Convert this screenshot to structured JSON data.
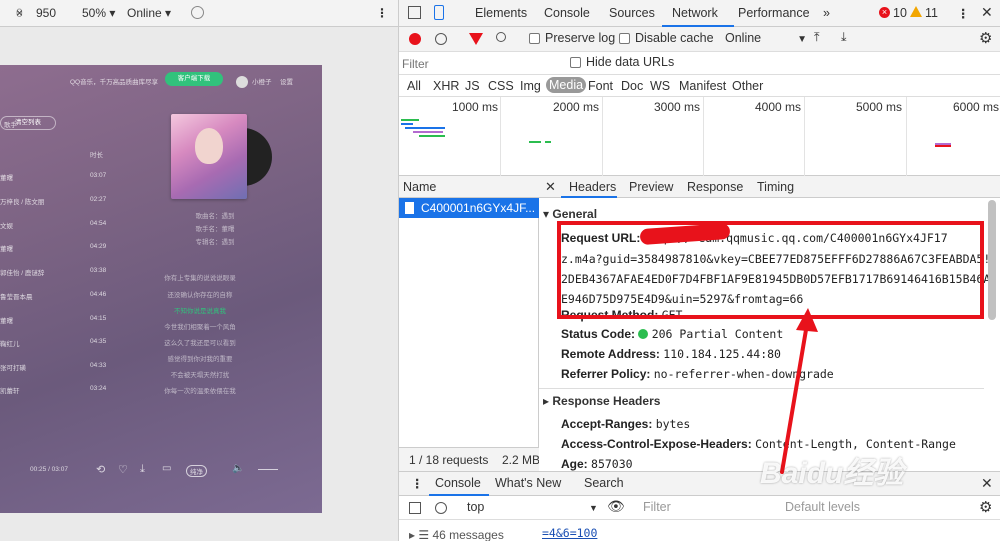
{
  "device_toolbar": {
    "x_sep": "×",
    "height": "950",
    "zoom": "50%",
    "network": "Online"
  },
  "phone": {
    "promo": "QQ音乐，千万高品质曲库尽享",
    "download_btn": "客户端下载",
    "user": "小橙子",
    "settings": "设置",
    "clear_btn": "清空列表",
    "col_singer": "歌手",
    "col_duration": "时长",
    "songs": [
      {
        "title": "",
        "singer": "董曙",
        "time": "03:07"
      },
      {
        "title": "",
        "singer": "万梓良 / 陈文丽",
        "time": "02:27"
      },
      {
        "title": "",
        "singer": "文娱",
        "time": "04:54"
      },
      {
        "title": "",
        "singer": "董曙",
        "time": "04:29"
      },
      {
        "title": "",
        "singer": "郭佳怡 / 鹿谜辞",
        "time": "03:38"
      },
      {
        "title": "",
        "singer": "鲁莹晋本晨",
        "time": "04:46"
      },
      {
        "title": "",
        "singer": "董曙",
        "time": "04:15"
      },
      {
        "title": "",
        "singer": "鞠红儿",
        "time": "04:35"
      },
      {
        "title": "",
        "singer": "张可打磺",
        "time": "04:33"
      },
      {
        "title": "",
        "singer": "凯蕾轩",
        "time": "03:24"
      }
    ],
    "meta": [
      "歌曲名：遇到",
      "歌手名：董曙",
      "专辑名：遇到"
    ],
    "lyrics": [
      "你有上专集的说说说眼录",
      "还没确认你存在的自称",
      "不知你说是说真我",
      "今世我们相聚着一个风角",
      "这么久了我还是可以看到",
      "感觉得到你对我的重要",
      "不会被天塌天然打扰",
      "你每一次的温柔依偎在我"
    ],
    "time_display": "00:25 / 03:07",
    "quality": "纯净"
  },
  "devtools": {
    "tabs": [
      "Elements",
      "Console",
      "Sources",
      "Network",
      "Performance",
      "»"
    ],
    "errors": "10",
    "warnings": "11",
    "preserve_log": "Preserve log",
    "disable_cache": "Disable cache",
    "throttle": "Online",
    "filter_placeholder": "Filter",
    "hide_data_urls": "Hide data URLs",
    "type_filters": [
      "All",
      "XHR",
      "JS",
      "CSS",
      "Img",
      "Media",
      "Font",
      "Doc",
      "WS",
      "Manifest",
      "Other"
    ],
    "timeline_ticks": [
      "1000 ms",
      "2000 ms",
      "3000 ms",
      "4000 ms",
      "5000 ms",
      "6000 ms"
    ],
    "name_header": "Name",
    "request_name": "C400001n6GYx4JF...",
    "request_count": "1 / 18 requests",
    "transferred": "2.2 MB",
    "detail_tabs": [
      "Headers",
      "Preview",
      "Response",
      "Timing"
    ],
    "general_title": "General",
    "request_url_label": "Request URL:",
    "request_url_lines": [
      "http://            eam.qqmusic.qq.com/C400001n6GYx4JF17",
      "z.m4a?guid=3584987810&vkey=CBEE77ED875EFFF6D27886A67C3FEABDA5!",
      "2DEB4367AFAE4ED0F7D4FBF1AF9E81945DB0D57EFB1717B69146416B15B46A",
      "E946D75D975E4D9&uin=5297&fromtag=66"
    ],
    "request_method_label": "Request Method:",
    "request_method": "GET",
    "status_code_label": "Status Code:",
    "status_code": "206 Partial Content",
    "remote_address_label": "Remote Address:",
    "remote_address": "110.184.125.44:80",
    "referrer_policy_label": "Referrer Policy:",
    "referrer_policy": "no-referrer-when-downgrade",
    "response_headers_title": "Response Headers",
    "accept_ranges_label": "Accept-Ranges:",
    "accept_ranges": "bytes",
    "acao_label": "Access-Control-Expose-Headers:",
    "acao": "Content-Length, Content-Range",
    "age_label": "Age:",
    "age": "857030",
    "drawer_tabs": [
      "Console",
      "What's New",
      "Search"
    ],
    "context": "top",
    "console_filter": "Filter",
    "default_levels": "Default levels",
    "messages": "46 messages",
    "console_snippet": "=4&6=100"
  },
  "watermark": "Baidu经验",
  "colors": {
    "accent": "#1a73e8",
    "annotation": "#e8121b",
    "qq_green": "#31c27c"
  }
}
